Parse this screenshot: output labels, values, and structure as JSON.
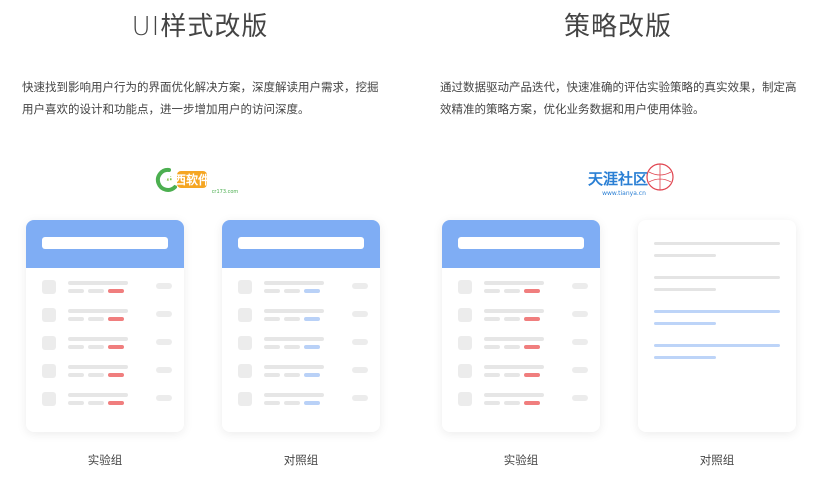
{
  "left": {
    "title": "UI样式改版",
    "description": "快速找到影响用户行为的界面优化解决方案，深度解读用户需求，挖掘用户喜欢的设计和功能点，进一步增加用户的访问深度。",
    "logo_text": "西西软件园",
    "logo_sub": "cr173.com",
    "experiment_label": "实验组",
    "control_label": "对照组"
  },
  "right": {
    "title": "策略改版",
    "description": "通过数据驱动产品迭代，快速准确的评估实验策略的真实效果，制定高效精准的策略方案，优化业务数据和用户使用体验。",
    "logo_text": "天涯社区",
    "logo_sub": "www.tianya.cn",
    "experiment_label": "实验组",
    "control_label": "对照组"
  },
  "colors": {
    "header_blue": "#7fadf4",
    "accent_red": "#f07e7e",
    "accent_blue": "#b9d1f7",
    "logo_green": "#4caf50",
    "logo_orange": "#f5a623",
    "tianya_blue": "#2a7fd4",
    "tianya_red": "#e0444f"
  }
}
